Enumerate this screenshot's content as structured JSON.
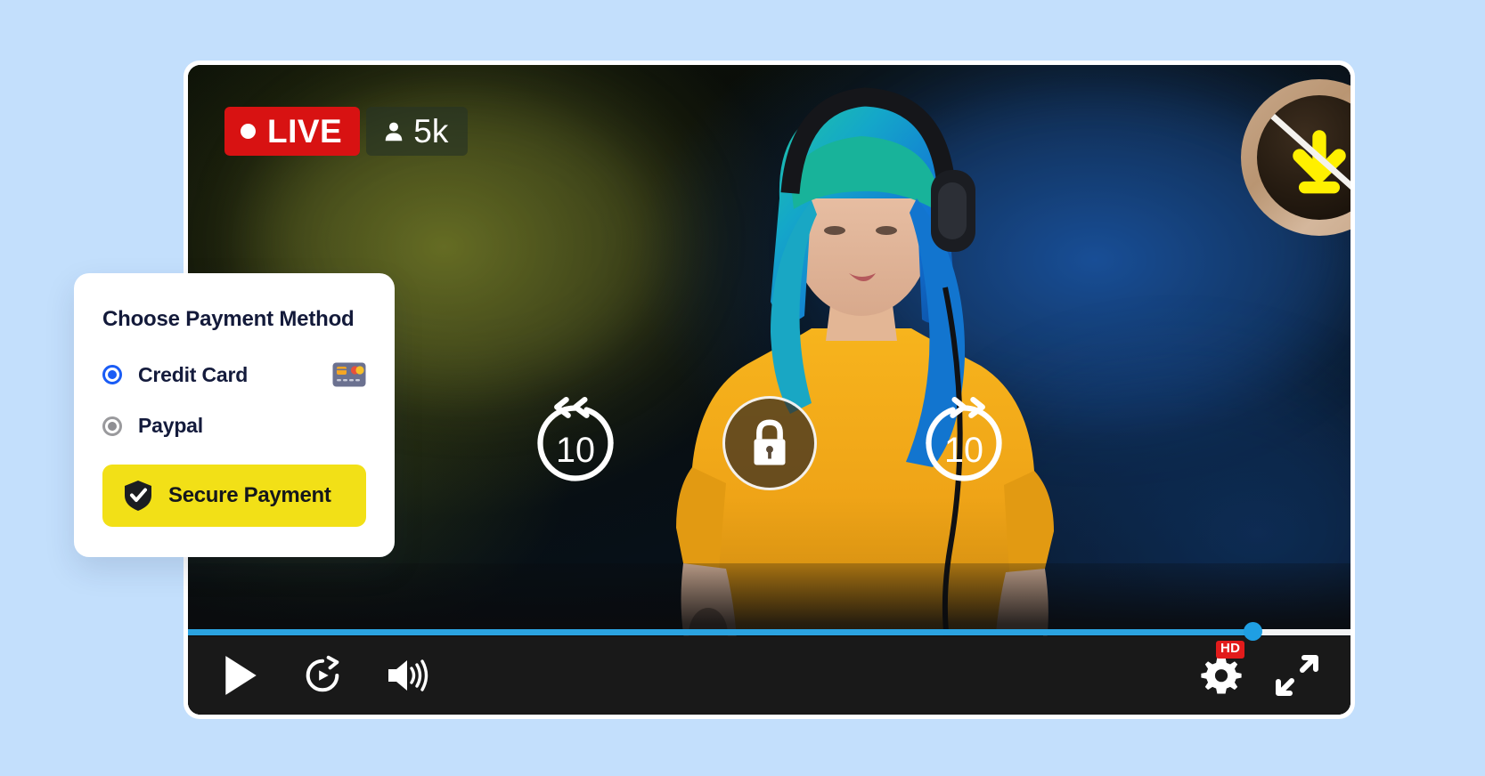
{
  "page": {
    "background_color": "#c3dffc"
  },
  "player": {
    "frame_color": "#ffffff",
    "live_badge": {
      "label": "LIVE",
      "color": "#d81212",
      "dot_icon": "live-dot-icon"
    },
    "viewer_badge": {
      "count": "5k",
      "person_icon": "person-icon"
    },
    "no_download_badge": {
      "icon": "download-blocked-icon",
      "arrow_color": "#fff000",
      "ring_color": "#c9a88a"
    },
    "center_controls": [
      {
        "name": "rewind-10-button",
        "label": "10",
        "icon": "rewind-10-icon"
      },
      {
        "name": "lock-button",
        "label": "",
        "icon": "lock-icon"
      },
      {
        "name": "forward-10-button",
        "label": "10",
        "icon": "forward-10-icon"
      }
    ],
    "progress": {
      "percent": 91.6,
      "fill_color": "#2ba3e0",
      "track_color": "#f2f3f4",
      "handle_color": "#1f9fe3"
    },
    "controls_left": [
      {
        "name": "play-button",
        "icon": "play-icon"
      },
      {
        "name": "replay-button",
        "icon": "replay-loop-icon"
      },
      {
        "name": "volume-button",
        "icon": "volume-icon"
      }
    ],
    "controls_right": [
      {
        "name": "settings-button",
        "icon": "gear-icon",
        "badge": "HD",
        "badge_color": "#e21b1b"
      },
      {
        "name": "fullscreen-button",
        "icon": "fullscreen-expand-icon"
      }
    ]
  },
  "payment_card": {
    "title": "Choose Payment Method",
    "options": [
      {
        "label": "Credit Card",
        "selected": true,
        "icon": "credit-card-icon",
        "radio_color": "#1a5cf5"
      },
      {
        "label": "Paypal",
        "selected": false,
        "icon": "",
        "radio_color": "#8f8f93"
      }
    ],
    "submit": {
      "label": "Secure Payment",
      "icon": "shield-check-icon",
      "background_color": "#f2e017",
      "text_color": "#15171c"
    }
  }
}
